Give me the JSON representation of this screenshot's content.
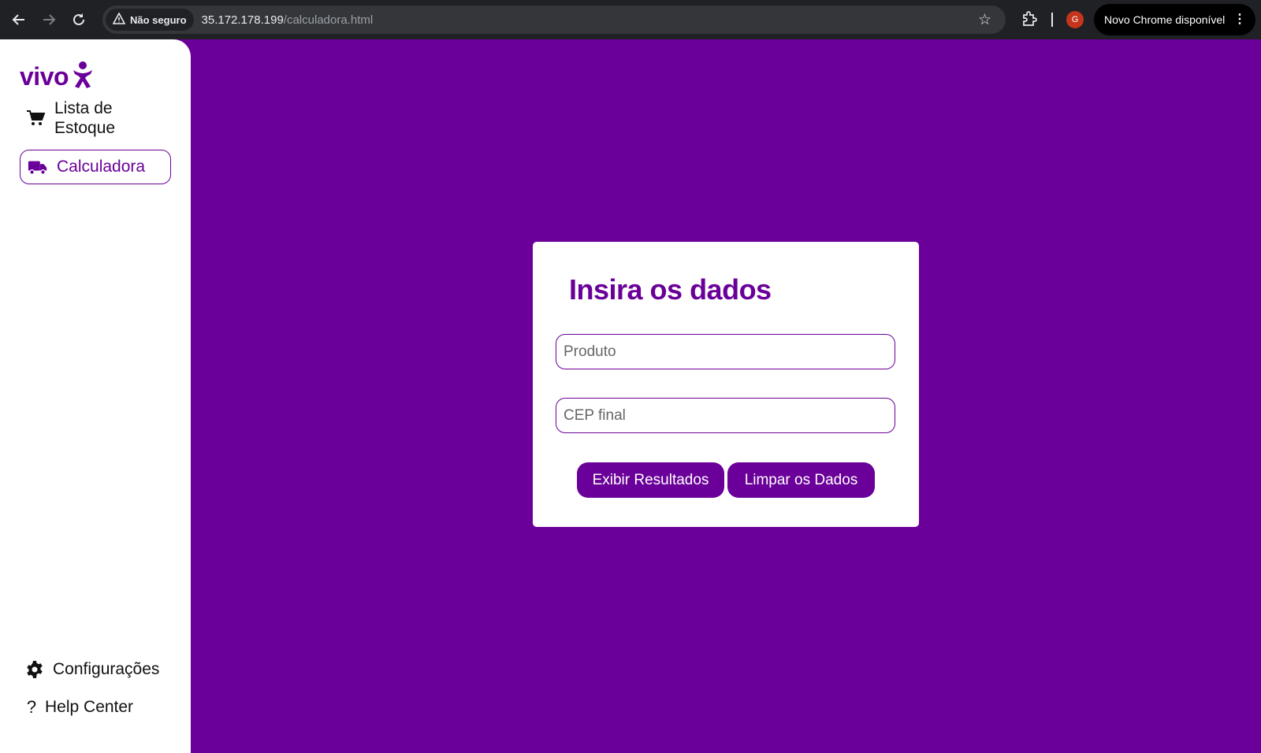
{
  "browser": {
    "security_label": "Não seguro",
    "url_host": "35.172.178.199",
    "url_path": "/calculadora.html",
    "profile_initial": "G",
    "update_label": "Novo Chrome disponível"
  },
  "sidebar": {
    "logo_text": "vivo",
    "items": [
      {
        "label": "Lista de Estoque",
        "icon": "cart-icon"
      },
      {
        "label": "Calculadora",
        "icon": "truck-icon",
        "active": true
      }
    ],
    "footer_items": [
      {
        "label": "Configurações",
        "icon": "gear-icon"
      },
      {
        "label": "Help Center",
        "icon": "question-icon"
      }
    ]
  },
  "form": {
    "title": "Insira os dados",
    "produto_placeholder": "Produto",
    "cep_placeholder": "CEP final",
    "show_button": "Exibir Resultados",
    "clear_button": "Limpar os Dados"
  },
  "colors": {
    "brand": "#6a0099",
    "chrome_bg": "#202124"
  }
}
